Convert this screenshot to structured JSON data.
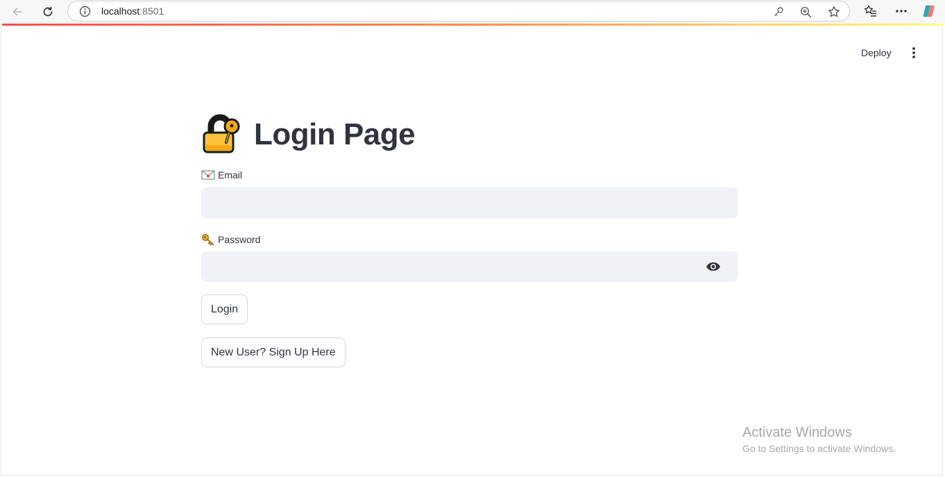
{
  "browser": {
    "url_host": "localhost",
    "url_port": ":8501"
  },
  "header": {
    "deploy_label": "Deploy"
  },
  "page": {
    "title": "Login Page",
    "title_icon": "lock-with-key-icon"
  },
  "form": {
    "email": {
      "label": "Email",
      "icon": "envelope-icon",
      "value": ""
    },
    "password": {
      "label": "Password",
      "icon": "key-icon",
      "value": ""
    },
    "login_label": "Login",
    "signup_label": "New User? Sign Up Here"
  },
  "watermark": {
    "title": "Activate Windows",
    "subtitle": "Go to Settings to activate Windows."
  },
  "colors": {
    "accent_gradient_start": "#ff4b4b",
    "accent_gradient_end": "#fffd80",
    "input_background": "#f0f2f6",
    "text": "#31333f"
  }
}
